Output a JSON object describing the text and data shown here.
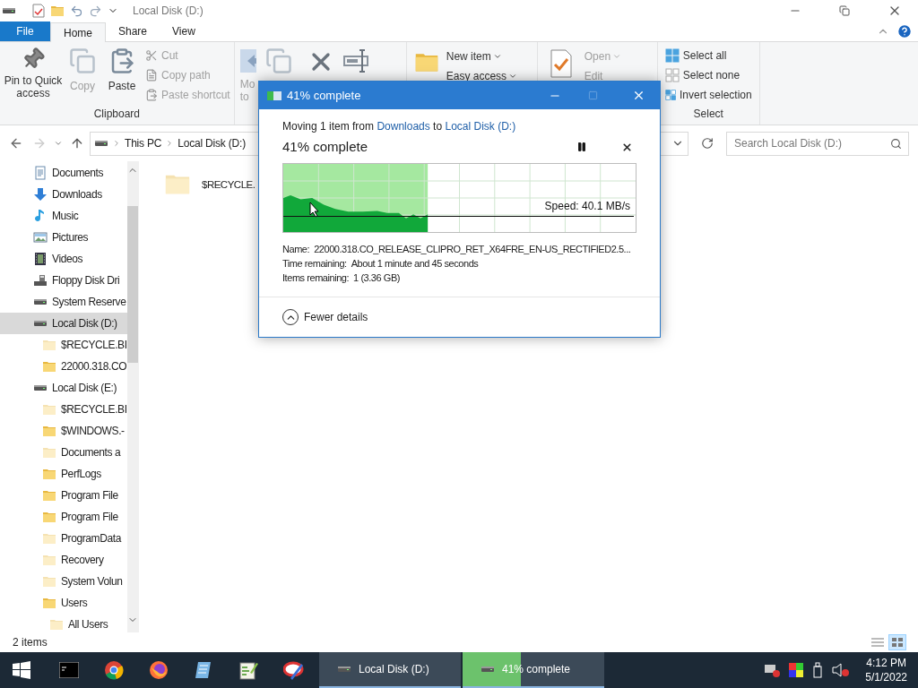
{
  "title_bar": {
    "title": "Local Disk (D:)"
  },
  "file_menu": {
    "label": "File"
  },
  "ribbon_tabs": [
    {
      "label": "Home",
      "selected": true
    },
    {
      "label": "Share",
      "selected": false
    },
    {
      "label": "View",
      "selected": false
    }
  ],
  "ribbon": {
    "clipboard": {
      "label": "Clipboard",
      "pin": {
        "label": "Pin to Quick access",
        "disabled": false
      },
      "copy": {
        "label": "Copy",
        "disabled": true
      },
      "paste": {
        "label": "Paste",
        "disabled": false
      },
      "cut": {
        "label": "Cut",
        "disabled": true
      },
      "copy_path": {
        "label": "Copy path",
        "disabled": true
      },
      "paste_shortcut": {
        "label": "Paste shortcut",
        "disabled": true
      }
    },
    "organize": {
      "move_to": {
        "label": "Mo to",
        "disabled": true
      }
    },
    "new": {
      "new_item": {
        "label": "New item",
        "disabled": false
      },
      "easy_access": {
        "label": "Easy access",
        "disabled": false
      }
    },
    "open": {
      "open": {
        "label": "Open",
        "disabled": true
      },
      "edit": {
        "label": "Edit",
        "disabled": true
      }
    },
    "select": {
      "label": "Select",
      "select_all": {
        "label": "Select all",
        "disabled": false
      },
      "select_none": {
        "label": "Select none",
        "disabled": false
      },
      "invert_selection": {
        "label": "Invert selection",
        "disabled": false
      }
    }
  },
  "navigation": {
    "back": {
      "disabled": false
    },
    "forward": {
      "disabled": true
    }
  },
  "address": {
    "crumbs": [
      "This PC",
      "Local Disk (D:)"
    ]
  },
  "search": {
    "placeholder": "Search Local Disk (D:)"
  },
  "sidebar": {
    "items": [
      {
        "label": "Documents",
        "kind": "documents",
        "selected": false
      },
      {
        "label": "Downloads",
        "kind": "downloads",
        "selected": false
      },
      {
        "label": "Music",
        "kind": "music",
        "selected": false
      },
      {
        "label": "Pictures",
        "kind": "pictures",
        "selected": false
      },
      {
        "label": "Videos",
        "kind": "videos",
        "selected": false
      },
      {
        "label": "Floppy Disk Dri",
        "kind": "floppy",
        "selected": false
      },
      {
        "label": "System Reserve",
        "kind": "drive",
        "selected": false
      },
      {
        "label": "Local Disk (D:)",
        "kind": "drive",
        "selected": true,
        "children": [
          {
            "label": "$RECYCLE.BI",
            "kind": "folder",
            "hidden": true,
            "selected": false
          },
          {
            "label": "22000.318.CO",
            "kind": "folder",
            "hidden": false,
            "selected": false
          }
        ]
      },
      {
        "label": "Local Disk (E:)",
        "kind": "drive",
        "selected": false,
        "children": [
          {
            "label": "$RECYCLE.BI",
            "kind": "folder",
            "hidden": true,
            "selected": false
          },
          {
            "label": "$WINDOWS.-",
            "kind": "folder",
            "hidden": false,
            "selected": false
          },
          {
            "label": "Documents a",
            "kind": "folder",
            "hidden": true,
            "selected": false
          },
          {
            "label": "PerfLogs",
            "kind": "folder",
            "hidden": false,
            "selected": false
          },
          {
            "label": "Program File",
            "kind": "folder",
            "hidden": false,
            "selected": false
          },
          {
            "label": "Program File",
            "kind": "folder",
            "hidden": false,
            "selected": false
          },
          {
            "label": "ProgramData",
            "kind": "folder",
            "hidden": true,
            "selected": false
          },
          {
            "label": "Recovery",
            "kind": "folder",
            "hidden": true,
            "selected": false
          },
          {
            "label": "System Volun",
            "kind": "folder",
            "hidden": true,
            "selected": false
          },
          {
            "label": "Users",
            "kind": "folder",
            "hidden": false,
            "selected": false,
            "children": [
              {
                "label": "All Users",
                "kind": "folder",
                "hidden": true,
                "selected": false
              }
            ]
          }
        ]
      }
    ]
  },
  "content": {
    "items": [
      {
        "name": "$RECYCLE.",
        "hidden": true
      }
    ]
  },
  "status_bar": {
    "item_count": "2 items",
    "details_view": {
      "selected": false
    },
    "large_icons_view": {
      "selected": true
    }
  },
  "copy_dialog": {
    "title": "41% complete",
    "maximize": {
      "disabled": true
    },
    "message": {
      "prefix": "Moving 1 item from",
      "source": "Downloads",
      "middle": "to",
      "destination": "Local Disk (D:)"
    },
    "heading": "41% complete",
    "progress": {
      "level": 0.41
    },
    "speed": "Speed: 40.1 MB/s",
    "details": [
      {
        "label": "Name:",
        "value": "22000.318.CO_RELEASE_CLIPRO_RET_X64FRE_EN-US_RECTIFIED2.5..."
      },
      {
        "label": "Time remaining:",
        "value": "About 1 minute and 45 seconds"
      },
      {
        "label": "Items remaining:",
        "value": "1 (3.36 GB)"
      }
    ],
    "toggle": {
      "label": "Fewer details",
      "expanded": true
    }
  },
  "taskbar": {
    "windows": [
      {
        "label": "Local Disk (D:)"
      },
      {
        "label": "41% complete",
        "level": 0.41
      }
    ],
    "clock": {
      "time": "4:12 PM",
      "date": "5/1/2022"
    }
  }
}
